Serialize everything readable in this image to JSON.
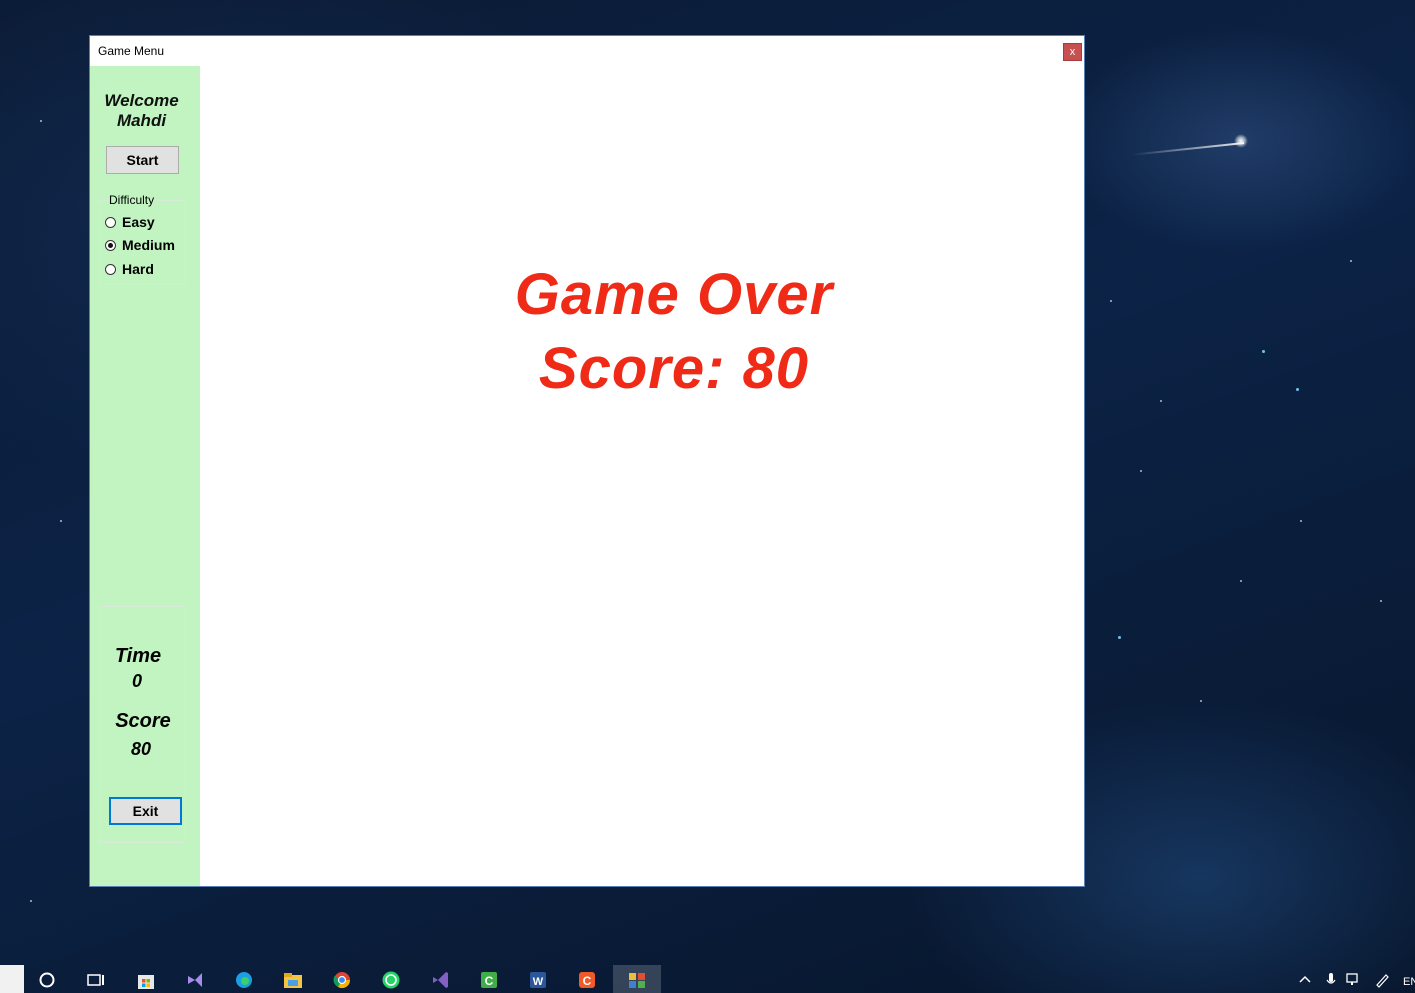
{
  "window": {
    "title": "Game Menu",
    "close_label": "x"
  },
  "sidebar": {
    "welcome_line1": "Welcome",
    "welcome_line2": "Mahdi",
    "start_label": "Start",
    "difficulty": {
      "legend": "Difficulty",
      "options": [
        {
          "label": "Easy",
          "checked": false
        },
        {
          "label": "Medium",
          "checked": true
        },
        {
          "label": "Hard",
          "checked": false
        }
      ]
    },
    "time_label": "Time",
    "time_value": "0",
    "score_label": "Score",
    "score_value": "80",
    "exit_label": "Exit"
  },
  "game": {
    "line1": "Game Over",
    "line2": "Score: 80"
  },
  "taskbar": {
    "language": "EN"
  },
  "colors": {
    "sidebar_bg": "#c1f4c1",
    "game_over_text": "#ef2a16",
    "close_button": "#c75050"
  }
}
